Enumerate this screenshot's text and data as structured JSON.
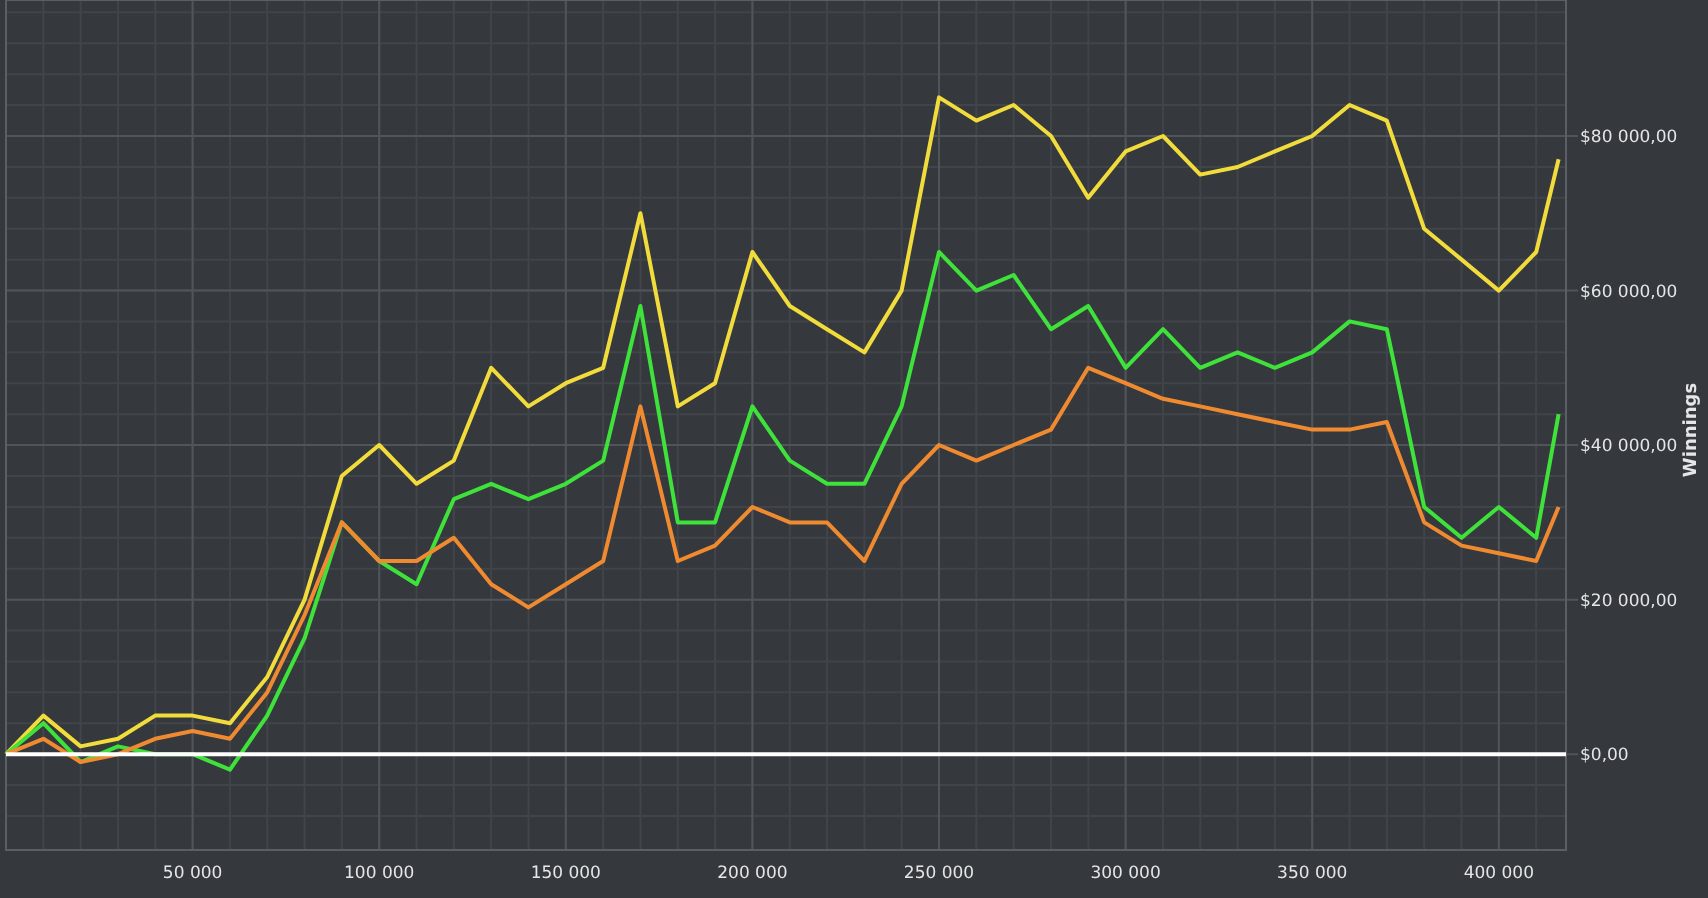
{
  "chart": {
    "chart_data": {
      "type": "line",
      "grid": true,
      "ylabel": "Winnings",
      "x": [
        0,
        10000,
        20000,
        30000,
        40000,
        50000,
        60000,
        70000,
        80000,
        90000,
        100000,
        110000,
        120000,
        130000,
        140000,
        150000,
        160000,
        170000,
        180000,
        190000,
        200000,
        210000,
        220000,
        230000,
        240000,
        250000,
        260000,
        270000,
        280000,
        290000,
        300000,
        310000,
        320000,
        330000,
        340000,
        350000,
        360000,
        370000,
        380000,
        390000,
        400000,
        410000,
        416000
      ],
      "xlim": [
        0,
        418000
      ],
      "ylim": [
        -12400,
        97600
      ],
      "xticks": [
        {
          "value": 50000,
          "label": "50 000"
        },
        {
          "value": 100000,
          "label": "100 000"
        },
        {
          "value": 150000,
          "label": "150 000"
        },
        {
          "value": 200000,
          "label": "200 000"
        },
        {
          "value": 250000,
          "label": "250 000"
        },
        {
          "value": 300000,
          "label": "300 000"
        },
        {
          "value": 350000,
          "label": "350 000"
        },
        {
          "value": 400000,
          "label": "400 000"
        }
      ],
      "yticks": [
        {
          "value": 0,
          "label": "$0,00"
        },
        {
          "value": 20000,
          "label": "$20 000,00"
        },
        {
          "value": 40000,
          "label": "$40 000,00"
        },
        {
          "value": 60000,
          "label": "$60 000,00"
        },
        {
          "value": 80000,
          "label": "$80 000,00"
        }
      ],
      "series": [
        {
          "color": "#f2dc3c",
          "values": [
            0,
            5000,
            1000,
            2000,
            5000,
            5000,
            4000,
            10000,
            20000,
            36000,
            40000,
            35000,
            38000,
            50000,
            45000,
            48000,
            50000,
            70000,
            45000,
            48000,
            65000,
            58000,
            55000,
            52000,
            60000,
            85000,
            82000,
            84000,
            80000,
            72000,
            78000,
            80000,
            75000,
            76000,
            78000,
            80000,
            84000,
            82000,
            68000,
            64000,
            60000,
            65000,
            77000
          ]
        },
        {
          "color": "#3ee23a",
          "values": [
            0,
            4000,
            -1000,
            1000,
            0,
            0,
            -2000,
            5000,
            15000,
            30000,
            25000,
            22000,
            33000,
            35000,
            33000,
            35000,
            38000,
            58000,
            30000,
            30000,
            45000,
            38000,
            35000,
            35000,
            45000,
            65000,
            60000,
            62000,
            55000,
            58000,
            50000,
            55000,
            50000,
            52000,
            50000,
            52000,
            56000,
            55000,
            32000,
            28000,
            32000,
            28000,
            44000
          ]
        },
        {
          "color": "#f08a30",
          "values": [
            0,
            2000,
            -1000,
            0,
            2000,
            3000,
            2000,
            8000,
            18000,
            30000,
            25000,
            25000,
            28000,
            22000,
            19000,
            22000,
            25000,
            45000,
            25000,
            27000,
            32000,
            30000,
            30000,
            25000,
            35000,
            40000,
            38000,
            40000,
            42000,
            50000,
            48000,
            46000,
            45000,
            44000,
            43000,
            42000,
            42000,
            43000,
            30000,
            27000,
            26000,
            25000,
            32000
          ]
        }
      ]
    }
  }
}
